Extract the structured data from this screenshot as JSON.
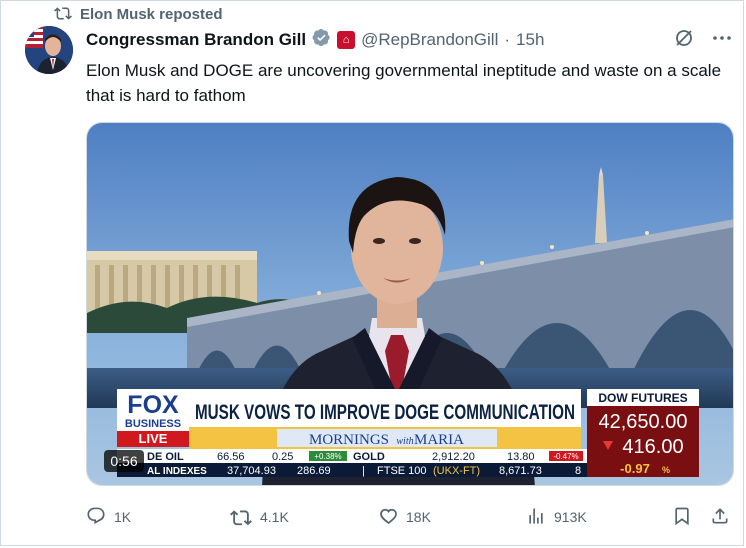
{
  "repost": {
    "text": "Elon Musk reposted"
  },
  "author": {
    "name": "Congressman Brandon Gill",
    "handle": "@RepBrandonGill",
    "time": "15h",
    "separator": "·"
  },
  "tweet": {
    "text": "Elon Musk and DOGE are uncovering governmental ineptitude and waste on a scale that is hard to fathom"
  },
  "video": {
    "duration": "0:56",
    "network": {
      "line1": "FOX",
      "line2": "BUSINESS",
      "live": "LIVE"
    },
    "headline": "MUSK VOWS TO IMPROVE DOGE COMMUNICATION",
    "show": {
      "name": "MORNINGS",
      "with": "with",
      "host": "MARIA"
    },
    "dow": {
      "label": "DOW FUTURES",
      "value": "42,650.00",
      "change": "416.00",
      "pct": "-0.97",
      "pct_unit": "%"
    },
    "ticker_row1": {
      "label": "DE OIL",
      "v1": "66.56",
      "v2": "0.25",
      "v3": "+0.38%",
      "label2": "GOLD",
      "v4": "2,912.20",
      "v5": "13.80",
      "v6": "-0.47%"
    },
    "ticker_row2": {
      "label": "AL INDEXES",
      "v1": "37,704.93",
      "v2": "286.69",
      "sep": "|",
      "label2": "FTSE 100",
      "label3": "(UKX-FT)",
      "v3": "8,671.73",
      "v4": "8"
    }
  },
  "actions": {
    "replies": "1K",
    "reposts": "4.1K",
    "likes": "18K",
    "views": "913K"
  },
  "colors": {
    "fox_red": "#d0191f",
    "fox_blue": "#1b3e8f",
    "dow_bg": "#7a0f12",
    "link_gray": "#536471"
  }
}
